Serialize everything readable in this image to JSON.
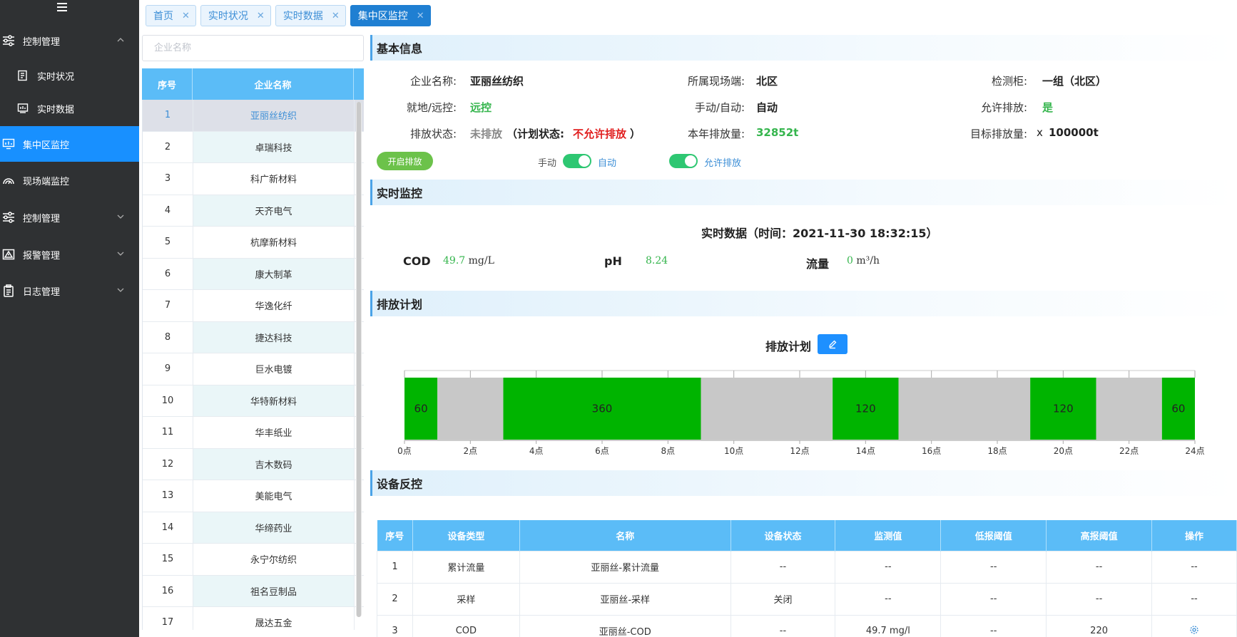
{
  "sidebar": {
    "items": [
      {
        "label": "控制管理",
        "icon": "sliders-icon",
        "expanded": true
      },
      {
        "label": "实时状况",
        "icon": "report-icon"
      },
      {
        "label": "实时数据",
        "icon": "chart-box-icon"
      },
      {
        "label": "集中区监控",
        "icon": "monitor-icon",
        "active": true
      },
      {
        "label": "现场端监控",
        "icon": "gauge-icon"
      },
      {
        "label": "控制管理",
        "icon": "sliders-icon"
      },
      {
        "label": "报警管理",
        "icon": "warning-icon"
      },
      {
        "label": "日志管理",
        "icon": "clipboard-icon"
      }
    ]
  },
  "tabs": [
    {
      "label": "首页"
    },
    {
      "label": "实时状况"
    },
    {
      "label": "实时数据"
    },
    {
      "label": "集中区监控",
      "active": true
    }
  ],
  "companyList": {
    "searchPlaceholder": "企业名称",
    "headers": {
      "index": "序号",
      "name": "企业名称"
    },
    "rows": [
      {
        "index": "1",
        "name": "亚丽丝纺织"
      },
      {
        "index": "2",
        "name": "卓瑞科技"
      },
      {
        "index": "3",
        "name": "科广新材料"
      },
      {
        "index": "4",
        "name": "天齐电气"
      },
      {
        "index": "5",
        "name": "杭摩新材料"
      },
      {
        "index": "6",
        "name": "康大制革"
      },
      {
        "index": "7",
        "name": "华逸化纤"
      },
      {
        "index": "8",
        "name": "捷达科技"
      },
      {
        "index": "9",
        "name": "巨水电镀"
      },
      {
        "index": "10",
        "name": "华特新材料"
      },
      {
        "index": "11",
        "name": "华丰纸业"
      },
      {
        "index": "12",
        "name": "吉木数码"
      },
      {
        "index": "13",
        "name": "美能电气"
      },
      {
        "index": "14",
        "name": "华缔药业"
      },
      {
        "index": "15",
        "name": "永宁尔纺织"
      },
      {
        "index": "16",
        "name": "祖名豆制品"
      },
      {
        "index": "17",
        "name": "晟达五金"
      }
    ]
  },
  "basicInfo": {
    "title": "基本信息",
    "companyLabel": "企业名称:",
    "companyValue": "亚丽丝纺织",
    "siteLabel": "所属现场端:",
    "siteValue": "北区",
    "cabinetLabel": "检测柜:",
    "cabinetValue": "一组（北区）",
    "localRemoteLabel": "就地/远控:",
    "localRemoteValue": "远控",
    "manualAutoLabel": "手动/自动:",
    "manualAutoValue": "自动",
    "allowLabel": "允许排放:",
    "allowValue": "是",
    "dischargeStatusLabel": "排放状态:",
    "dischargeStatusValue": "未排放",
    "planStatusLabel": "（计划状态:",
    "planStatusValue": "不允许排放",
    "planStatusClose": "）",
    "yearVolumeLabel": "本年排放量:",
    "yearVolumeValue": "32852t",
    "targetLabel": "目标排放量:",
    "targetPrefix": "x",
    "targetValue": "100000t",
    "startButton": "开启排放",
    "manualLabel": "手动",
    "autoLabel": "自动",
    "allowSwitchLabel": "允许排放"
  },
  "realtime": {
    "title": "实时监控",
    "dataTitle": "实时数据（时间：2021-11-30 18:32:15）",
    "codName": "COD",
    "codValue": "49.7",
    "codUnit": "mg/L",
    "phName": "pH",
    "phValue": "8.24",
    "flowName": "流量",
    "flowValue": "0",
    "flowUnit": "m³/h"
  },
  "plan": {
    "title": "排放计划",
    "chartTitle": "排放计划"
  },
  "chart_data": {
    "type": "bar",
    "orientation": "horizontal-timeline",
    "xlim": [
      0,
      24
    ],
    "xticks": [
      "0点",
      "2点",
      "4点",
      "6点",
      "8点",
      "10点",
      "12点",
      "14点",
      "16点",
      "18点",
      "20点",
      "22点",
      "24点"
    ],
    "segments": [
      {
        "start": 0,
        "end": 1,
        "label": "60",
        "state": "on"
      },
      {
        "start": 1,
        "end": 3,
        "label": "",
        "state": "off"
      },
      {
        "start": 3,
        "end": 9,
        "label": "360",
        "state": "on"
      },
      {
        "start": 9,
        "end": 13,
        "label": "",
        "state": "off"
      },
      {
        "start": 13,
        "end": 15,
        "label": "120",
        "state": "on"
      },
      {
        "start": 15,
        "end": 19,
        "label": "",
        "state": "off"
      },
      {
        "start": 19,
        "end": 21,
        "label": "120",
        "state": "on"
      },
      {
        "start": 21,
        "end": 23,
        "label": "",
        "state": "off"
      },
      {
        "start": 23,
        "end": 24,
        "label": "60",
        "state": "on"
      }
    ],
    "colors": {
      "on": "#00b400",
      "off": "#c8c8c8"
    }
  },
  "device": {
    "title": "设备反控",
    "headers": [
      "序号",
      "设备类型",
      "名称",
      "设备状态",
      "监测值",
      "低报阈值",
      "高报阈值",
      "操作"
    ],
    "rows": [
      [
        "1",
        "累计流量",
        "亚丽丝-累计流量",
        "--",
        "--",
        "--",
        "--",
        "--"
      ],
      [
        "2",
        "采样",
        "亚丽丝-采样",
        "关闭",
        "--",
        "--",
        "--",
        "--"
      ],
      [
        "3",
        "COD",
        "亚丽丝-COD",
        "--",
        "49.7 mg/l",
        "--",
        "220",
        "gear-icon"
      ]
    ]
  }
}
